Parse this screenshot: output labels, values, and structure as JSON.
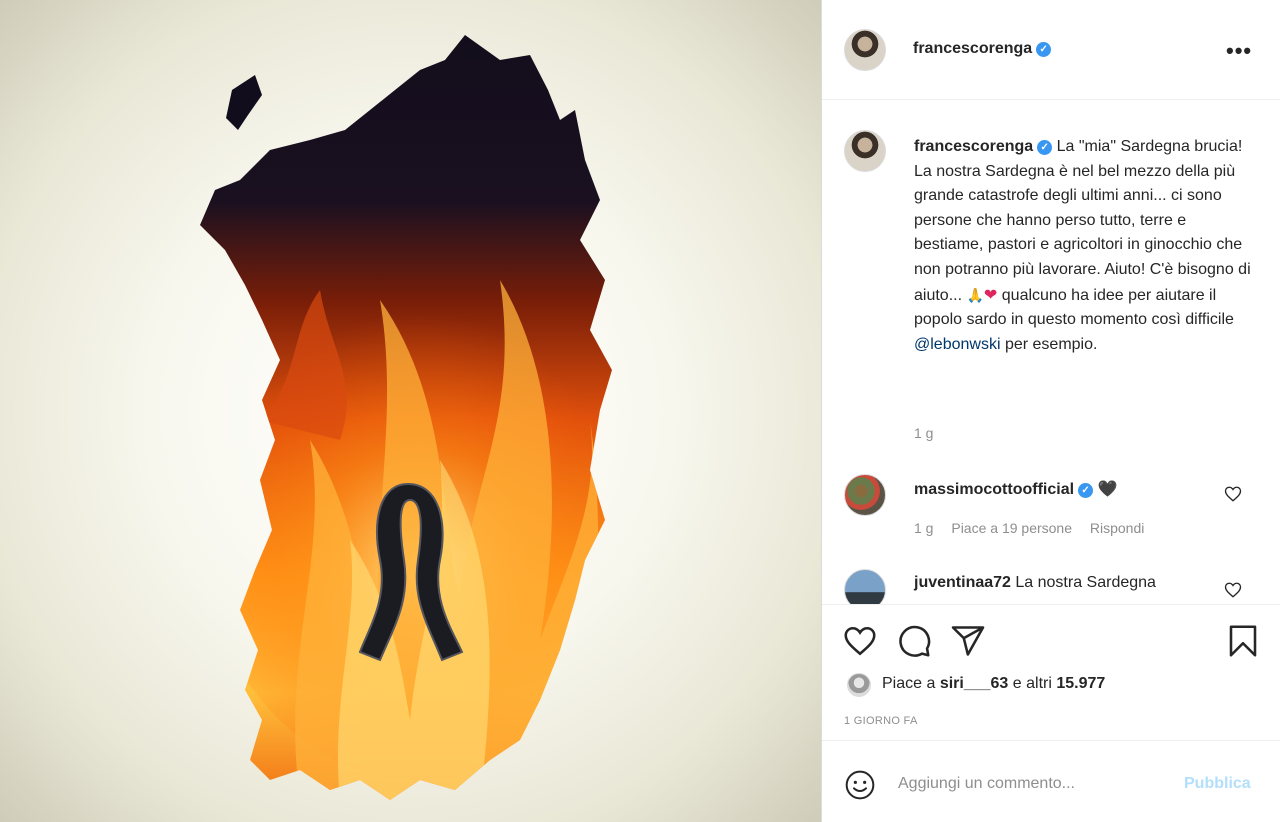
{
  "post": {
    "author": {
      "username": "francescorenga",
      "verified_mark": "✓"
    },
    "more_options_icon": "•••",
    "caption": {
      "username": "francescorenga",
      "text_part1": "La \"mia\" Sardegna brucia! La nostra Sardegna è nel bel mezzo della più grande catastrofe degli ultimi anni... ci sono persone che hanno perso tutto, terre e bestiame, pastori e agricoltori in ginocchio che non potranno più lavorare. Aiuto! C'è bisogno di aiuto... ",
      "emoji_pray": "🙏",
      "emoji_heart": "❤",
      "text_part2": " qualcuno ha idee per aiutare il popolo sardo in questo momento così difficile ",
      "mention": "@lebonwski",
      "text_part3": " per esempio.",
      "time": "1 g"
    },
    "comments": [
      {
        "username": "massimocottoofficial",
        "text": "🖤",
        "time": "1 g",
        "likes_label": "Piace a 19 persone",
        "reply_label": "Rispondi"
      },
      {
        "username": "juventinaa72",
        "text": "La nostra Sardegna"
      }
    ],
    "likes": {
      "prefix": "Piace a ",
      "user": "siri___63",
      "suffix": " e altri ",
      "count": "15.977"
    },
    "date": "1 GIORNO FA",
    "comment_box": {
      "placeholder": "Aggiungi un commento...",
      "publish_label": "Pubblica"
    },
    "icons": {
      "like": "heart-outline",
      "comment": "speech-bubble",
      "share": "paper-plane",
      "save": "bookmark",
      "emoji": "smiley"
    },
    "colors": {
      "link": "#00376b",
      "verified": "#3897f0",
      "publish_disabled": "#b2dffc",
      "muted": "#8e8e8e"
    }
  }
}
